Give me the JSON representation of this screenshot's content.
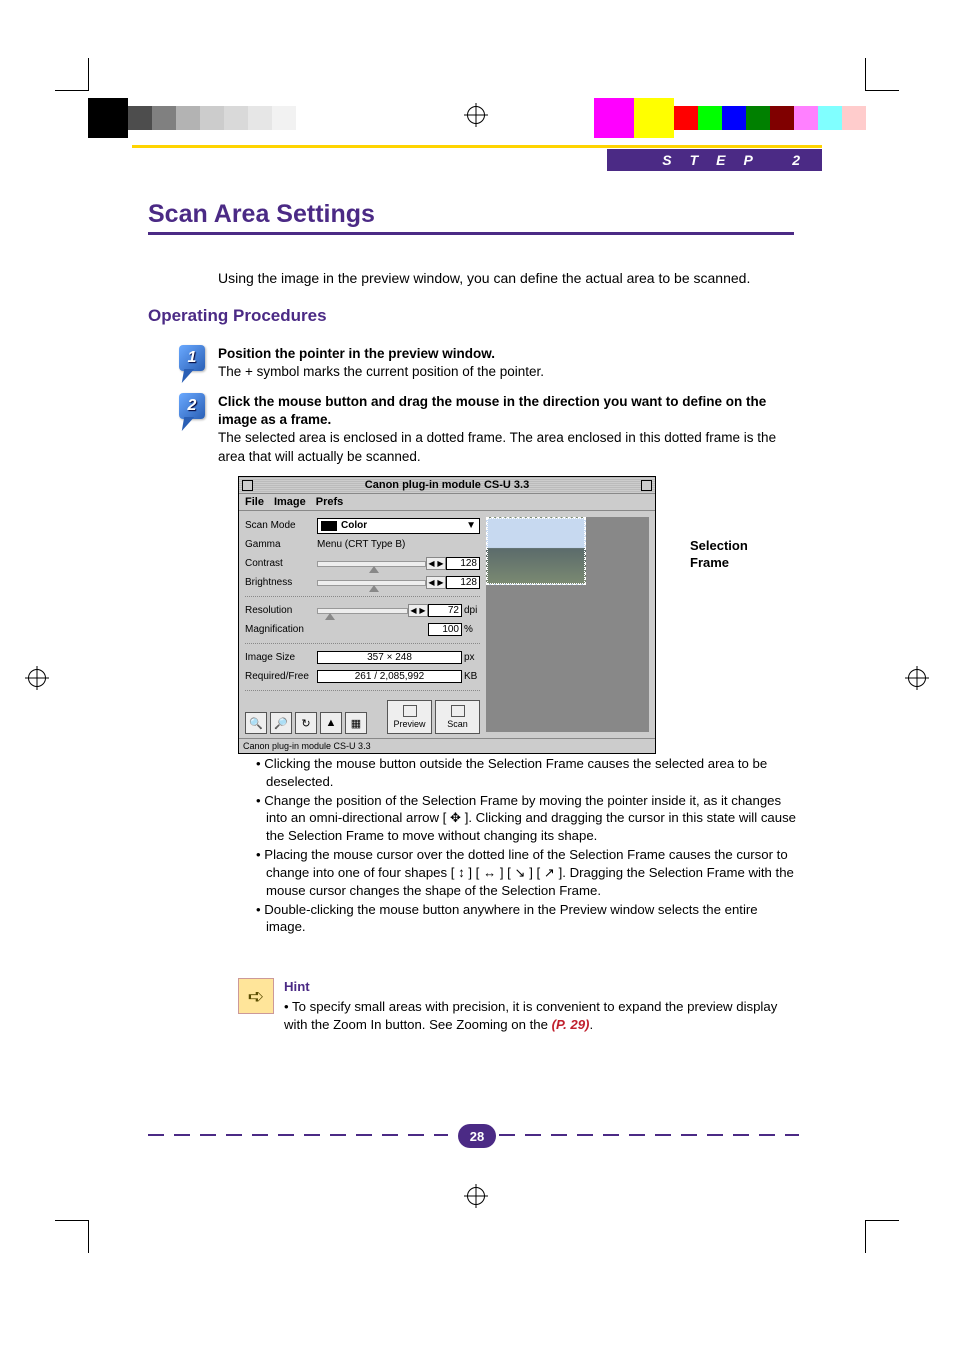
{
  "header": {
    "step_label": "STEP 2"
  },
  "page_title": "Scan Area Settings",
  "intro": "Using the image in the preview window, you can define the actual area to be scanned.",
  "section_heading": "Operating Procedures",
  "steps": [
    {
      "num": "1",
      "bold": "Position the pointer in the preview window.",
      "body": "The + symbol marks the current position of the pointer."
    },
    {
      "num": "2",
      "bold": "Click the mouse button and drag the mouse in the direction you want to define on the image as a frame.",
      "body": "The selected area is enclosed in a dotted frame.  The area enclosed in this dotted frame is the area that will actually be scanned."
    }
  ],
  "figure": {
    "caption_line1": "Selection",
    "caption_line2": "Frame",
    "window_title": "Canon plug-in module CS-U 3.3",
    "menus": {
      "file": "File",
      "image": "Image",
      "prefs": "Prefs"
    },
    "rows": {
      "scan_mode_label": "Scan Mode",
      "scan_mode_value": "Color",
      "gamma_label": "Gamma",
      "gamma_value": "Menu (CRT Type B)",
      "contrast_label": "Contrast",
      "contrast_value": "128",
      "brightness_label": "Brightness",
      "brightness_value": "128",
      "resolution_label": "Resolution",
      "resolution_value": "72",
      "resolution_unit": "dpi",
      "magnification_label": "Magnification",
      "magnification_value": "100",
      "magnification_unit": "%",
      "image_size_label": "Image Size",
      "image_size_value": "357 × 248",
      "image_size_unit": "px",
      "required_label": "Required/Free",
      "required_value": "261 / 2,085,992",
      "required_unit": "KB",
      "preview_btn": "Preview",
      "scan_btn": "Scan"
    },
    "status": "Canon plug-in module CS-U 3.3"
  },
  "bullets": [
    "Clicking the mouse button outside the Selection Frame causes the selected area to be deselected.",
    "Change the position of the Selection Frame by moving the pointer inside it, as it changes into an omni-directional arrow [ ✥ ]. Clicking and dragging the cursor in this state will cause the Selection Frame to move without changing its shape.",
    "Placing the mouse cursor over the dotted line of the Selection Frame causes the cursor to change into one of four shapes [ ↕ ] [ ↔ ] [ ↘ ] [ ↗ ]. Dragging the Selection Frame with the mouse cursor changes the shape of the Selection Frame.",
    "Double-clicking the mouse button anywhere in the Preview window selects the entire image."
  ],
  "hint": {
    "title": "Hint",
    "body_prefix": "• To specify small areas with precision, it is convenient to expand the preview display with the Zoom In button. See Zooming on the ",
    "ref": "(P. 29)",
    "body_suffix": "."
  },
  "page_number": "28",
  "colorbars": {
    "left": [
      "#000000",
      "#4d4d4d",
      "#808080",
      "#b3b3b3",
      "#cccccc",
      "#d9d9d9",
      "#e6e6e6",
      "#f2f2f2"
    ],
    "right_big": [
      "#ff00ff",
      "#ffff00"
    ],
    "right": [
      "#ff0000",
      "#00ff00",
      "#0000ff",
      "#008000",
      "#800000",
      "#ff80ff",
      "#80ffff",
      "#ffcccc"
    ]
  }
}
